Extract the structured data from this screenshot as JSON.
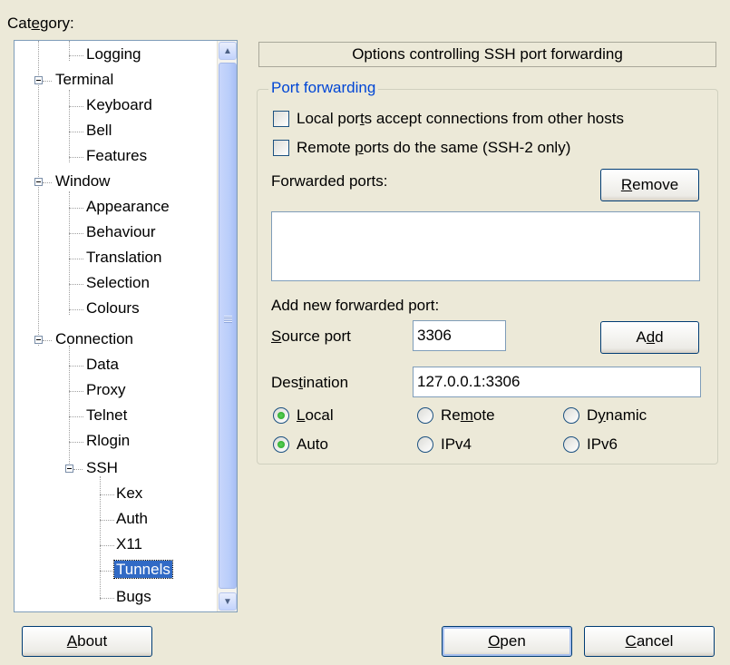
{
  "category_label": "Category:",
  "tree": [
    {
      "label": "Logging",
      "level": 2
    },
    {
      "label": "Terminal",
      "level": 1,
      "expanded": true
    },
    {
      "label": "Keyboard",
      "level": 2
    },
    {
      "label": "Bell",
      "level": 2
    },
    {
      "label": "Features",
      "level": 2
    },
    {
      "label": "Window",
      "level": 1,
      "expanded": true
    },
    {
      "label": "Appearance",
      "level": 2
    },
    {
      "label": "Behaviour",
      "level": 2
    },
    {
      "label": "Translation",
      "level": 2
    },
    {
      "label": "Selection",
      "level": 2
    },
    {
      "label": "Colours",
      "level": 2
    },
    {
      "label": "Connection",
      "level": 1,
      "expanded": true
    },
    {
      "label": "Data",
      "level": 2
    },
    {
      "label": "Proxy",
      "level": 2
    },
    {
      "label": "Telnet",
      "level": 2
    },
    {
      "label": "Rlogin",
      "level": 2
    },
    {
      "label": "SSH",
      "level": 2,
      "expanded": true
    },
    {
      "label": "Kex",
      "level": 3
    },
    {
      "label": "Auth",
      "level": 3
    },
    {
      "label": "X11",
      "level": 3
    },
    {
      "label": "Tunnels",
      "level": 3,
      "selected": true
    },
    {
      "label": "Bugs",
      "level": 3
    }
  ],
  "panel": {
    "header": "Options controlling SSH port forwarding",
    "group_title": "Port forwarding",
    "local_ports_checkbox": {
      "label": "Local ports accept connections from other hosts",
      "checked": false
    },
    "remote_ports_checkbox": {
      "label": "Remote ports do the same (SSH-2 only)",
      "checked": false
    },
    "forwarded_ports_label": "Forwarded ports:",
    "remove_button": "Remove",
    "add_new_label": "Add new forwarded port:",
    "source_port_label": "Source port",
    "source_port_value": "3306",
    "add_button": "Add",
    "destination_label": "Destination",
    "destination_value": "127.0.0.1:3306",
    "direction_options": [
      "Local",
      "Remote",
      "Dynamic"
    ],
    "direction_selected": "Local",
    "ip_options": [
      "Auto",
      "IPv4",
      "IPv6"
    ],
    "ip_selected": "Auto"
  },
  "buttons": {
    "about": "About",
    "open": "Open",
    "cancel": "Cancel"
  }
}
